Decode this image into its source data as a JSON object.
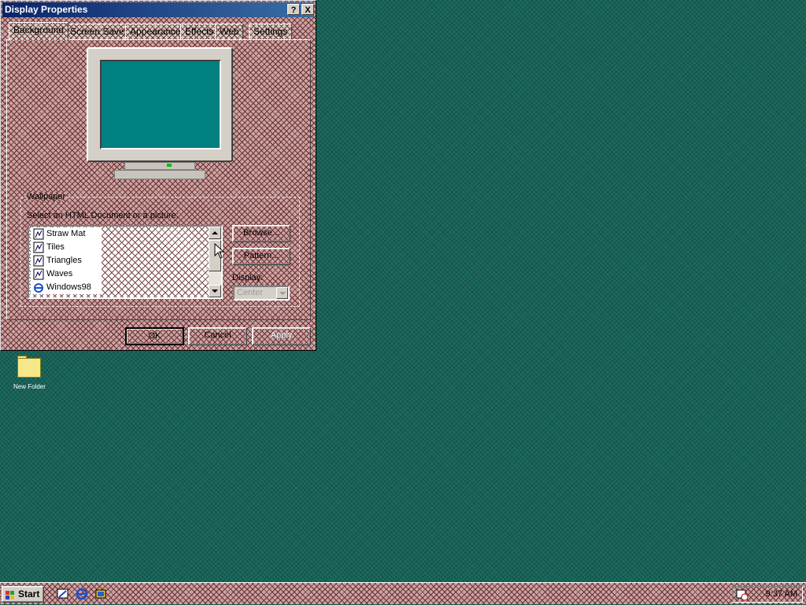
{
  "window": {
    "title": "Display Properties",
    "help_btn": "?",
    "close_btn": "X"
  },
  "tabs": [
    {
      "label": "Background",
      "active": true
    },
    {
      "label": "Screen Saver"
    },
    {
      "label": "Appearance"
    },
    {
      "label": "Effects"
    },
    {
      "label": "Web"
    },
    {
      "label": "Settings"
    }
  ],
  "wallpaper": {
    "group_label": "Wallpaper",
    "prompt": "Select an HTML Document or a picture:",
    "items": [
      {
        "label": "Straw Mat",
        "icon": "bitmap-icon"
      },
      {
        "label": "Tiles",
        "icon": "bitmap-icon"
      },
      {
        "label": "Triangles",
        "icon": "bitmap-icon"
      },
      {
        "label": "Waves",
        "icon": "bitmap-icon"
      },
      {
        "label": "Windows98",
        "icon": "html-document-icon"
      }
    ],
    "browse_label": "Browse...",
    "pattern_label": "Pattern...",
    "display_label": "Display:",
    "display_value": "Center"
  },
  "footer": {
    "ok": "OK",
    "cancel": "Cancel",
    "apply": "Apply"
  },
  "desktop": {
    "folder_label": "New Folder"
  },
  "taskbar": {
    "start_label": "Start",
    "clock": "9:37 AM"
  },
  "colors": {
    "desktop": "#1c6a5e",
    "preview_screen": "#008080",
    "titlebar": "#0a246a"
  }
}
